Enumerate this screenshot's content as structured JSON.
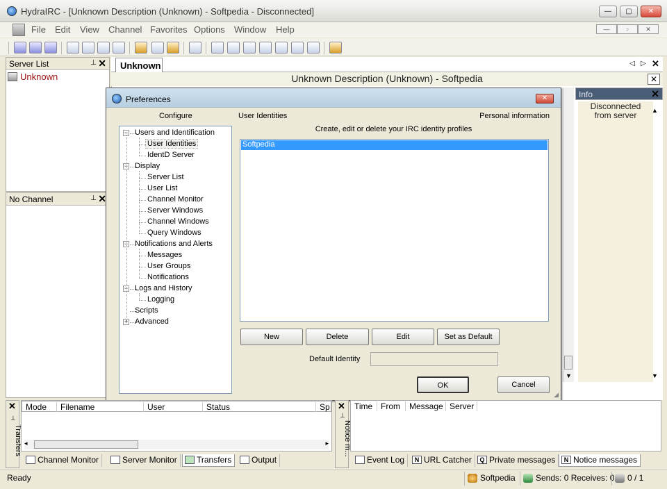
{
  "window": {
    "title": "HydraIRC - [Unknown Description (Unknown) - Softpedia - Disconnected]"
  },
  "menu": [
    "File",
    "Edit",
    "View",
    "Channel",
    "Favorites",
    "Options",
    "Window",
    "Help"
  ],
  "server_list": {
    "title": "Server List",
    "item": "Unknown"
  },
  "no_channel": {
    "title": "No Channel"
  },
  "tab": {
    "label": "Unknown"
  },
  "channel": {
    "topic": "Unknown Description (Unknown) - Softpedia"
  },
  "info": {
    "title": "Info",
    "text_line1": "Disconnected",
    "text_line2": "from server"
  },
  "prefs": {
    "title": "Preferences",
    "configure_label": "Configure",
    "section_title": "User Identities",
    "section_right": "Personal information",
    "description": "Create, edit or delete your IRC identity profiles",
    "identities": [
      "Softpedia"
    ],
    "tree": [
      {
        "label": "Users and Identification",
        "level": 0,
        "expander": "−"
      },
      {
        "label": "User Identities",
        "level": 1,
        "selected": true
      },
      {
        "label": "IdentD Server",
        "level": 1
      },
      {
        "label": "Display",
        "level": 0,
        "expander": "−"
      },
      {
        "label": "Server List",
        "level": 1
      },
      {
        "label": "User List",
        "level": 1
      },
      {
        "label": "Channel Monitor",
        "level": 1
      },
      {
        "label": "Server Windows",
        "level": 1
      },
      {
        "label": "Channel Windows",
        "level": 1
      },
      {
        "label": "Query Windows",
        "level": 1
      },
      {
        "label": "Notifications and Alerts",
        "level": 0,
        "expander": "−"
      },
      {
        "label": "Messages",
        "level": 1
      },
      {
        "label": "User Groups",
        "level": 1
      },
      {
        "label": "Notifications",
        "level": 1
      },
      {
        "label": "Logs and History",
        "level": 0,
        "expander": "−"
      },
      {
        "label": "Logging",
        "level": 1
      },
      {
        "label": "Scripts",
        "level": 0
      },
      {
        "label": "Advanced",
        "level": 0,
        "expander": "+"
      }
    ],
    "buttons": {
      "new": "New",
      "delete": "Delete",
      "edit": "Edit",
      "set_default": "Set as Default",
      "ok": "OK",
      "cancel": "Cancel"
    },
    "default_identity_label": "Default Identity",
    "default_identity_value": ""
  },
  "transfers": {
    "columns": [
      "Mode",
      "Filename",
      "User",
      "Status",
      "Sp"
    ],
    "side_label": "Transfers",
    "tabs": [
      "Channel Monitor",
      "Server Monitor",
      "Transfers",
      "Output"
    ],
    "active_tab": "Transfers"
  },
  "notices": {
    "columns": [
      "Time",
      "From",
      "Message",
      "Server"
    ],
    "side_label": "Notice m...",
    "tabs": [
      "Event Log",
      "URL Catcher",
      "Private messages",
      "Notice messages"
    ],
    "active_tab": "Notice messages"
  },
  "status": {
    "ready": "Ready",
    "identity": "Softpedia",
    "traffic": "Sends: 0 Receives: 0",
    "count": "0 / 1"
  }
}
